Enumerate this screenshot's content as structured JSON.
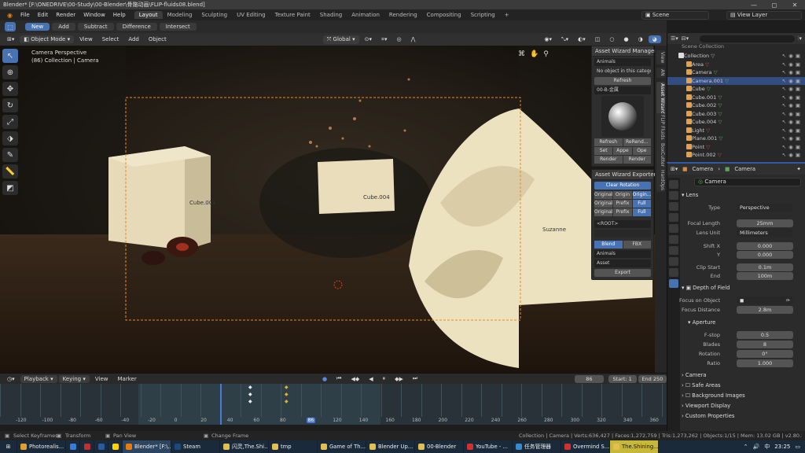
{
  "titlebar": {
    "title": "Blender* [F:\\ONEDRIVE\\00-Study\\00-Blender\\骨骼动画\\FLIP-fluids08.blend]",
    "min": "—",
    "max": "◻",
    "close": "✕"
  },
  "menu": {
    "items": [
      "File",
      "Edit",
      "Render",
      "Window",
      "Help"
    ]
  },
  "workspaces": [
    "Layout",
    "Modeling",
    "Sculpting",
    "UV Editing",
    "Texture Paint",
    "Shading",
    "Animation",
    "Rendering",
    "Compositing",
    "Scripting",
    "+"
  ],
  "scene_field": "Scene",
  "viewlayer_field": "View Layer",
  "tool_header": {
    "modes": [
      "New",
      "Add",
      "Subtract",
      "Difference",
      "Intersect"
    ]
  },
  "viewport_header": {
    "mode": "Object Mode",
    "menus": [
      "View",
      "Select",
      "Add",
      "Object"
    ],
    "orientation": "Global"
  },
  "viewport": {
    "overlay_title": "Camera Perspective",
    "overlay_sub": "(86) Collection | Camera",
    "labels": {
      "cube001": "Cube.001",
      "cube004": "Cube.004",
      "suzanne": "Suzanne"
    }
  },
  "npanel": {
    "manager_title": "Asset Wizard Manager",
    "category": "Animals",
    "no_object": "No object in this catego...",
    "refresh": "Refresh",
    "material_cat": "00-B-金属",
    "btns_row1": [
      "Refresh",
      "ReRend..."
    ],
    "btns_row2": [
      "Set",
      "Appe",
      "Ope"
    ],
    "btns_row3": [
      "Render",
      "Render"
    ],
    "exporter_title": "Asset Wizard Exporter",
    "clear_rotation": "Clear Rotation",
    "grid1": [
      "Original",
      "Origin",
      "Origin..."
    ],
    "grid2": [
      "Original",
      "Prefix",
      "Full"
    ],
    "grid3": [
      "Original",
      "Prefix",
      "Full"
    ],
    "root": "<ROOT>",
    "blend": "Blend",
    "fbx": "FBX",
    "export_cat": "Animals",
    "asset_name": "Asset",
    "export": "Export"
  },
  "vtabs": [
    "View",
    "AN",
    "Asset Wizard",
    "FLIP Fluids",
    "BoxCutter",
    "HardOps"
  ],
  "outliner": {
    "header": "Scene Collection",
    "items": [
      {
        "name": "Collection",
        "type": "collection",
        "indent": 0
      },
      {
        "name": "Area",
        "type": "light",
        "indent": 1
      },
      {
        "name": "Camera",
        "type": "camera",
        "indent": 1
      },
      {
        "name": "Camera.001",
        "type": "camera",
        "indent": 1,
        "selected": true
      },
      {
        "name": "Cube",
        "type": "mesh",
        "indent": 1
      },
      {
        "name": "Cube.001",
        "type": "mesh",
        "indent": 1
      },
      {
        "name": "Cube.002",
        "type": "mesh",
        "indent": 1
      },
      {
        "name": "Cube.003",
        "type": "mesh",
        "indent": 1
      },
      {
        "name": "Cube.004",
        "type": "mesh",
        "indent": 1
      },
      {
        "name": "Light",
        "type": "light",
        "indent": 1
      },
      {
        "name": "Plane.001",
        "type": "mesh",
        "indent": 1
      },
      {
        "name": "Point",
        "type": "light",
        "indent": 1
      },
      {
        "name": "Point.002",
        "type": "light",
        "indent": 1
      }
    ]
  },
  "properties": {
    "breadcrumb1": "Camera",
    "breadcrumb2": "Camera",
    "datablock": "Camera",
    "lens": {
      "title": "Lens",
      "type_label": "Type",
      "type": "Perspective",
      "focal_label": "Focal Length",
      "focal": "25mm",
      "unit_label": "Lens Unit",
      "unit": "Millimeters",
      "shiftx_label": "Shift X",
      "shiftx": "0.000",
      "shifty_label": "Y",
      "shifty": "0.000",
      "clipstart_label": "Clip Start",
      "clipstart": "0.1m",
      "clipend_label": "End",
      "clipend": "100m"
    },
    "dof": {
      "title": "Depth of Field",
      "focus_obj_label": "Focus on Object",
      "focus_dist_label": "Focus Distance",
      "focus_dist": "2.8m",
      "aperture_title": "Aperture",
      "fstop_label": "F-stop",
      "fstop": "0.5",
      "blades_label": "Blades",
      "blades": "8",
      "rotation_label": "Rotation",
      "rotation": "0°",
      "ratio_label": "Ratio",
      "ratio": "1.000"
    },
    "sections": [
      "Camera",
      "Safe Areas",
      "Background Images",
      "Viewport Display",
      "Custom Properties"
    ]
  },
  "timeline": {
    "menus": [
      "Playback",
      "Keying",
      "View",
      "Marker"
    ],
    "current": "86",
    "start_label": "Start:",
    "start": "1",
    "end_label": "End",
    "end": "250",
    "ticks": [
      "-120",
      "-100",
      "-80",
      "-60",
      "-40",
      "-20",
      "0",
      "20",
      "40",
      "60",
      "80",
      "86",
      "120",
      "140",
      "160",
      "180",
      "200",
      "220",
      "240",
      "260",
      "280",
      "300",
      "320",
      "340",
      "360"
    ]
  },
  "statusbar": {
    "hints": [
      "Select Keyframes",
      "Transform",
      "Pan View",
      "Change Frame"
    ],
    "stats": "Collection | Camera | Verts:636,427 | Faces:1,272,759 | Tris:1,273,262 | Objects:1/15 | Mem: 13.02 GB | v2.80.57"
  },
  "taskbar": {
    "items": [
      {
        "label": "Photorealis...",
        "color": "#e0a030"
      },
      {
        "label": "",
        "color": "#3a7bd5"
      },
      {
        "label": "",
        "color": "#c03030"
      },
      {
        "label": "",
        "color": "#2a5aa0"
      },
      {
        "label": "",
        "color": "#ffd200"
      },
      {
        "label": "Blender* [F:\\...",
        "color": "#e87d0d"
      },
      {
        "label": "Steam",
        "color": "#1b4a7a"
      },
      {
        "label": "闪灵,The.Shi...",
        "color": "#e0c050"
      },
      {
        "label": "tmp",
        "color": "#e0c050"
      },
      {
        "label": "Game of Th...",
        "color": "#e0c050"
      },
      {
        "label": "Blender Up...",
        "color": "#e0c050"
      },
      {
        "label": "00-Blender",
        "color": "#e0c050"
      },
      {
        "label": "YouTube - ...",
        "color": "#d03030"
      },
      {
        "label": "任务管理器",
        "color": "#3a8ad0"
      },
      {
        "label": "Overmind S...",
        "color": "#d03030"
      },
      {
        "label": "The.Shining...",
        "color": "#e0c050"
      }
    ],
    "clock": "23:25",
    "lang": "中"
  }
}
